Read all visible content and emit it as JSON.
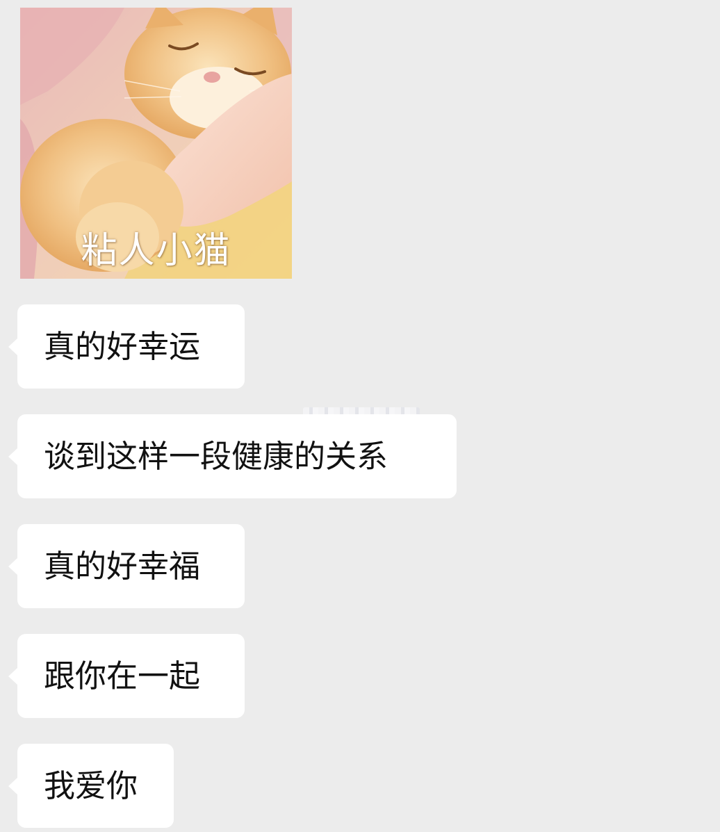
{
  "sticker": {
    "caption": "粘人小猫",
    "icon": "sleeping-cat-hugging-arm"
  },
  "messages": [
    {
      "text": "真的好幸运"
    },
    {
      "text": "谈到这样一段健康的关系"
    },
    {
      "text": "真的好幸福"
    },
    {
      "text": "跟你在一起"
    },
    {
      "text": "我爱你"
    }
  ],
  "colors": {
    "background": "#ececec",
    "bubble": "#ffffff",
    "text": "#111111"
  }
}
